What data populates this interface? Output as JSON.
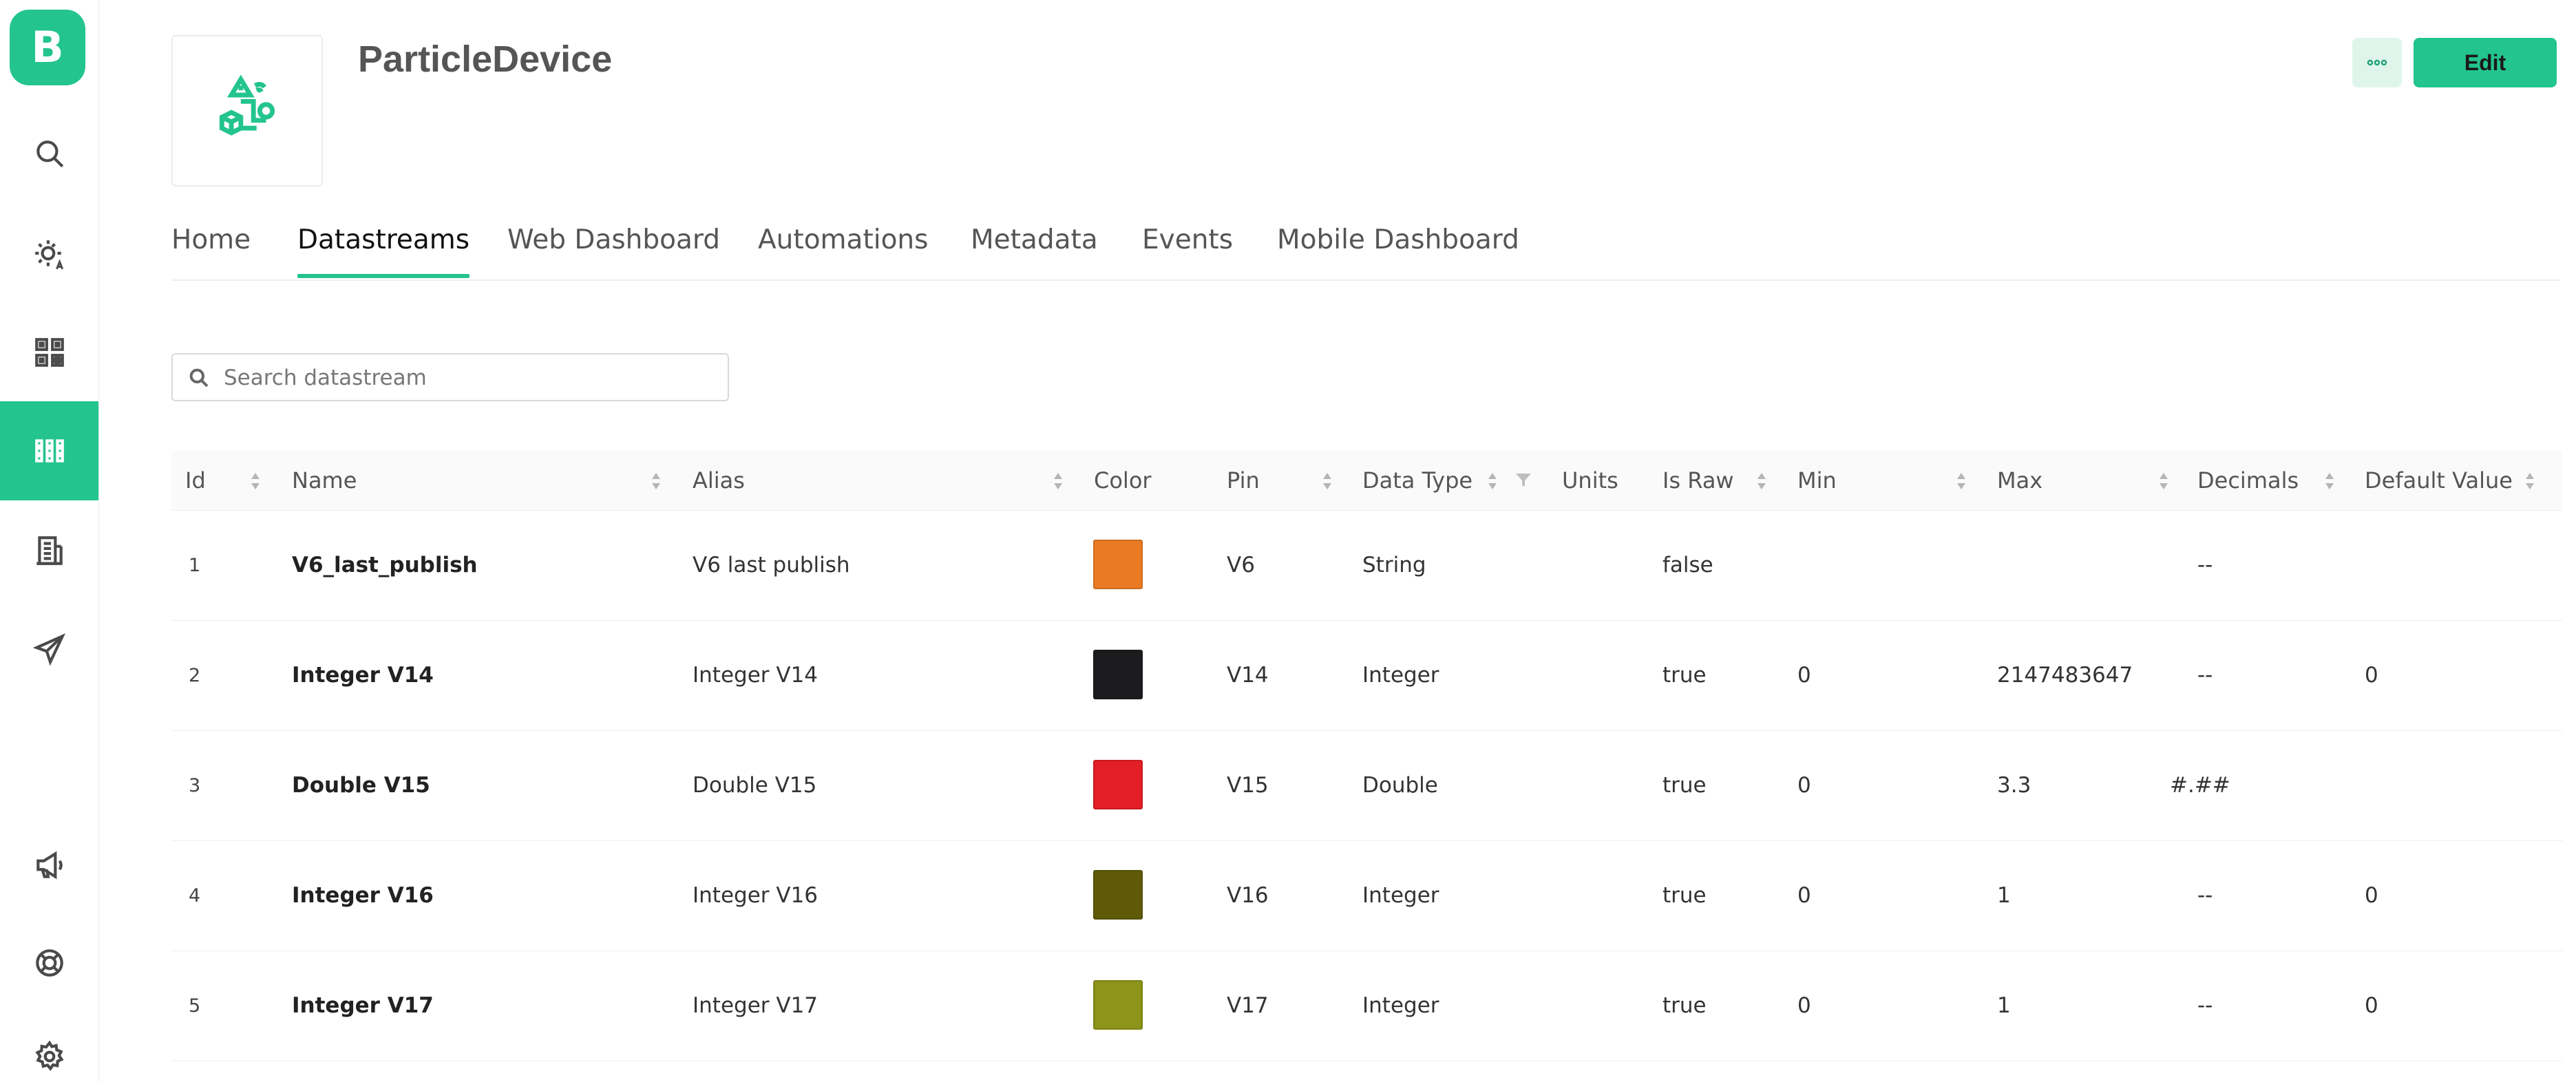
{
  "app": {
    "logo_letter": "B"
  },
  "sidebar": {
    "items": [
      {
        "icon": "search-icon"
      },
      {
        "icon": "sun-auto-icon"
      },
      {
        "icon": "qr-code-icon"
      },
      {
        "icon": "grid-apps-icon",
        "active": true
      },
      {
        "icon": "building-icon"
      },
      {
        "icon": "paper-plane-icon"
      },
      {
        "icon": "megaphone-icon"
      },
      {
        "icon": "lifebuoy-icon"
      },
      {
        "icon": "gear-icon"
      }
    ]
  },
  "header": {
    "title": "ParticleDevice",
    "more_icon": "more-dots-icon",
    "edit_label": "Edit"
  },
  "tabs": [
    {
      "label": "Home"
    },
    {
      "label": "Datastreams",
      "active": true
    },
    {
      "label": "Web Dashboard"
    },
    {
      "label": "Automations"
    },
    {
      "label": "Metadata"
    },
    {
      "label": "Events"
    },
    {
      "label": "Mobile Dashboard"
    }
  ],
  "search": {
    "placeholder": "Search datastream",
    "value": ""
  },
  "table": {
    "columns": [
      {
        "label": "Id",
        "sortable": true
      },
      {
        "label": "Name",
        "sortable": true
      },
      {
        "label": "Alias",
        "sortable": true
      },
      {
        "label": "Color",
        "sortable": false
      },
      {
        "label": "Pin",
        "sortable": true
      },
      {
        "label": "Data Type",
        "sortable": true,
        "filterable": true
      },
      {
        "label": "Units",
        "sortable": false
      },
      {
        "label": "Is Raw",
        "sortable": true
      },
      {
        "label": "Min",
        "sortable": true
      },
      {
        "label": "Max",
        "sortable": true
      },
      {
        "label": "Decimals",
        "sortable": true
      },
      {
        "label": "Default Value",
        "sortable": true
      }
    ],
    "rows": [
      {
        "id": "1",
        "name": "V6_last_publish",
        "alias": "V6 last publish",
        "color": "#ea7b24",
        "pin": "V6",
        "data_type": "String",
        "units": "",
        "is_raw": "false",
        "min": "",
        "max": "",
        "decimals": "--",
        "default_value": ""
      },
      {
        "id": "2",
        "name": "Integer V14",
        "alias": "Integer V14",
        "color": "#1c1c1e",
        "pin": "V14",
        "data_type": "Integer",
        "units": "",
        "is_raw": "true",
        "min": "0",
        "max": "2147483647",
        "decimals": "--",
        "default_value": "0"
      },
      {
        "id": "3",
        "name": "Double V15",
        "alias": "Double V15",
        "color": "#e31e24",
        "pin": "V15",
        "data_type": "Double",
        "units": "",
        "is_raw": "true",
        "min": "0",
        "max": "3.3",
        "decimals": "#.##",
        "default_value": ""
      },
      {
        "id": "4",
        "name": "Integer V16",
        "alias": "Integer V16",
        "color": "#5f5a08",
        "pin": "V16",
        "data_type": "Integer",
        "units": "",
        "is_raw": "true",
        "min": "0",
        "max": "1",
        "decimals": "--",
        "default_value": "0"
      },
      {
        "id": "5",
        "name": "Integer V17",
        "alias": "Integer V17",
        "color": "#8c9419",
        "pin": "V17",
        "data_type": "Integer",
        "units": "",
        "is_raw": "true",
        "min": "0",
        "max": "1",
        "decimals": "--",
        "default_value": "0"
      }
    ]
  }
}
